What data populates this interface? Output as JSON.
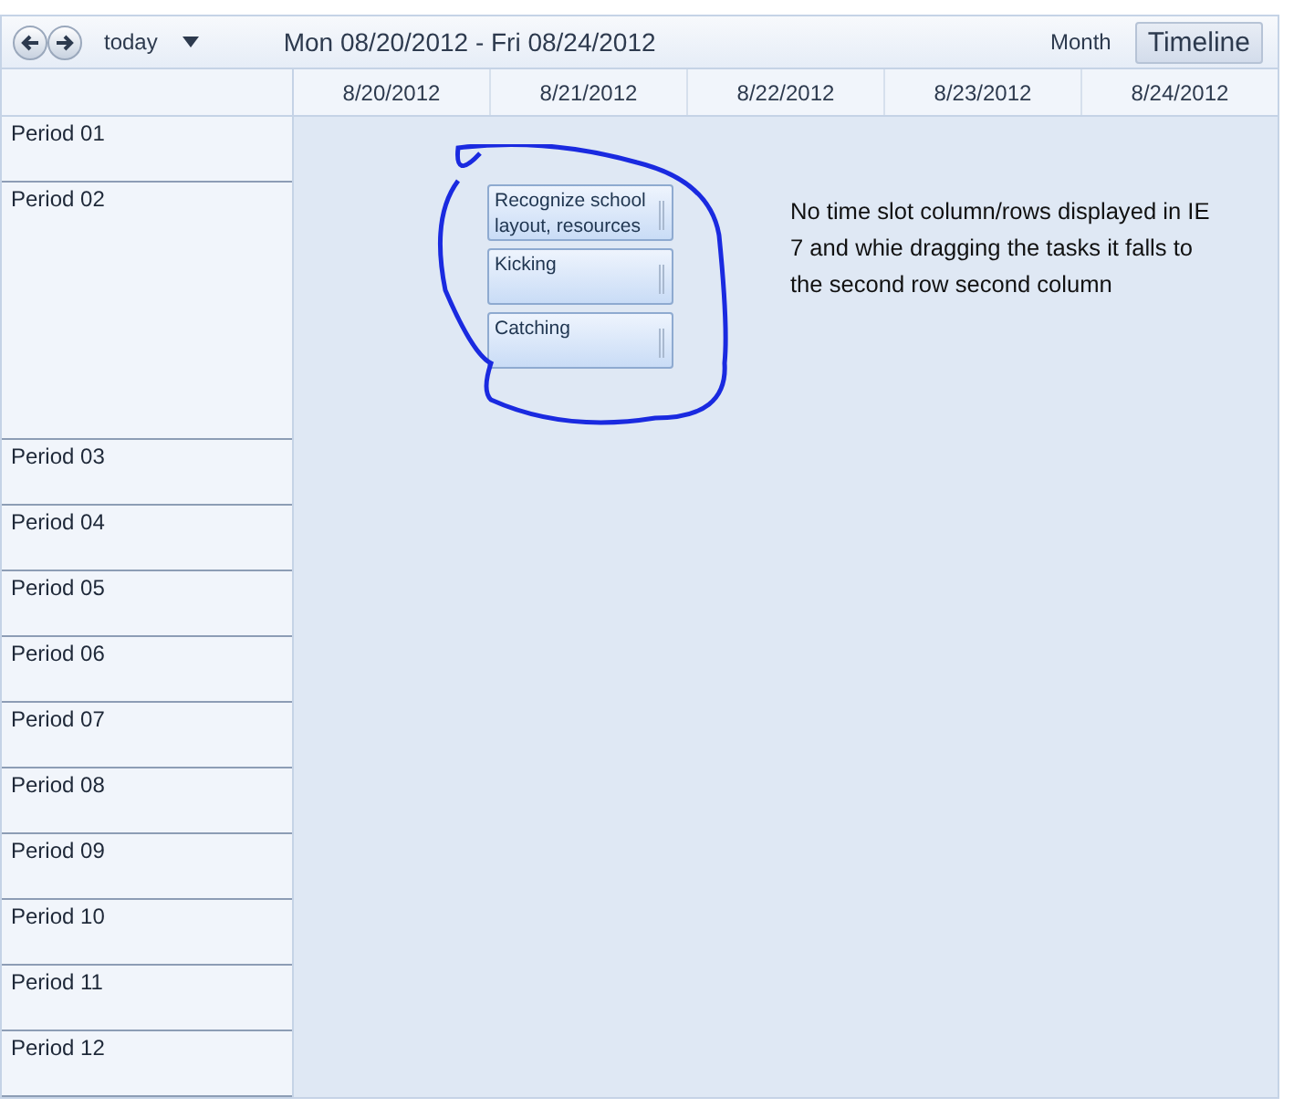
{
  "toolbar": {
    "today": "today",
    "range": "Mon 08/20/2012 - Fri 08/24/2012",
    "views": [
      {
        "label": "Month",
        "selected": false
      },
      {
        "label": "Timeline",
        "selected": true
      }
    ]
  },
  "columns": [
    "8/20/2012",
    "8/21/2012",
    "8/22/2012",
    "8/23/2012",
    "8/24/2012"
  ],
  "rows": [
    {
      "label": "Period 01",
      "tall": false
    },
    {
      "label": "Period 02",
      "tall": true
    },
    {
      "label": "Period 03",
      "tall": false
    },
    {
      "label": "Period 04",
      "tall": false
    },
    {
      "label": "Period 05",
      "tall": false
    },
    {
      "label": "Period 06",
      "tall": false
    },
    {
      "label": "Period 07",
      "tall": false
    },
    {
      "label": "Period 08",
      "tall": false
    },
    {
      "label": "Period 09",
      "tall": false
    },
    {
      "label": "Period 10",
      "tall": false
    },
    {
      "label": "Period 11",
      "tall": false
    },
    {
      "label": "Period 12",
      "tall": false
    }
  ],
  "tasks": [
    {
      "title": "Recognize school layout, resources"
    },
    {
      "title": "Kicking"
    },
    {
      "title": "Catching"
    }
  ],
  "annotation": "No time slot column/rows displayed in IE 7 and whie dragging the tasks it falls to the second row second column"
}
